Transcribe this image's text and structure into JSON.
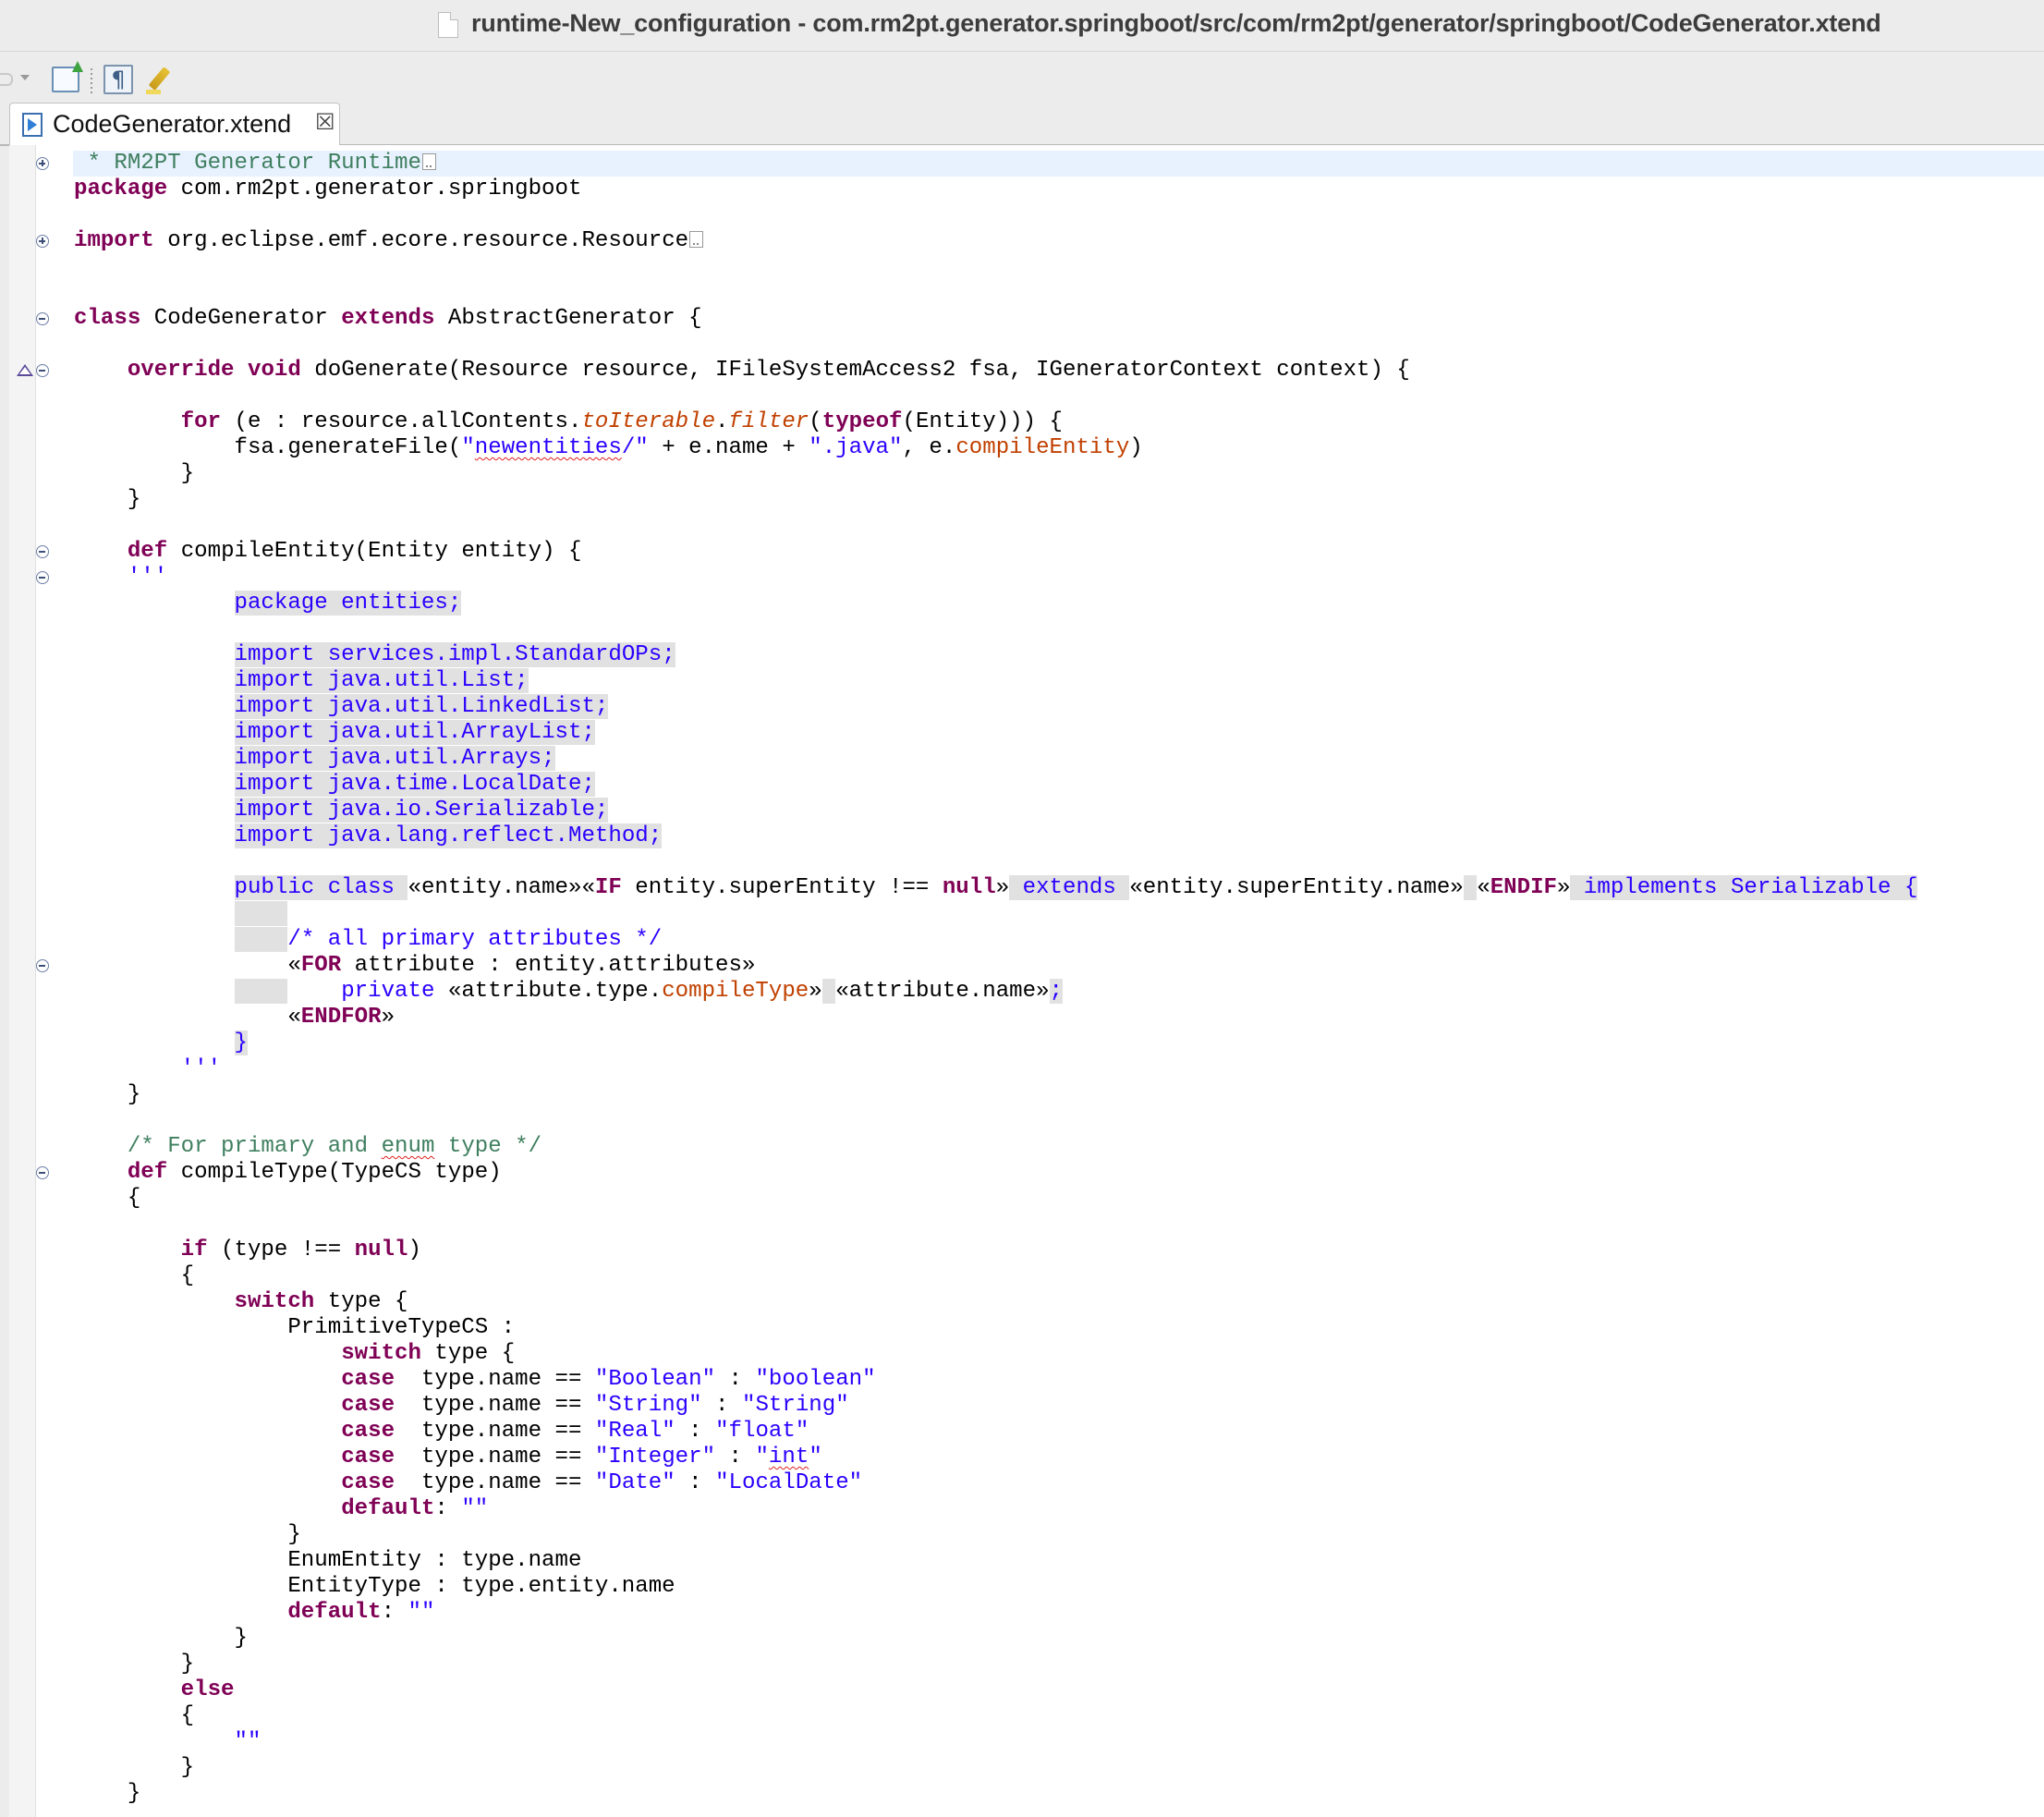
{
  "window": {
    "title": "runtime-New_configuration - com.rm2pt.generator.springboot/src/com/rm2pt/generator/springboot/CodeGenerator.xtend"
  },
  "toolbar": {
    "pilcrow_glyph": "¶",
    "icons": [
      "back-arrow-icon",
      "dropdown-icon",
      "new-wizard-icon",
      "pilcrow-icon",
      "highlight-icon"
    ]
  },
  "tab": {
    "label": "CodeGenerator.xtend",
    "close_glyph": "☒"
  },
  "colors": {
    "keyword": "#7f0055",
    "comment": "#3f7f5f",
    "string": "#2a00ff",
    "extension": "#c04000",
    "template_bg": "#e1e1e1",
    "current_line": "#e8f2fe"
  },
  "code_lines": [
    [
      {
        "t": "cm",
        "v": " * RM2PT Generator Runtime"
      },
      {
        "t": "fold"
      }
    ],
    [
      {
        "t": "kw",
        "v": "package"
      },
      {
        "t": "tk",
        "v": " com.rm2pt.generator.springboot"
      }
    ],
    [],
    [
      {
        "t": "kw",
        "v": "import"
      },
      {
        "t": "tk",
        "v": " org.eclipse.emf.ecore.resource.Resource"
      },
      {
        "t": "fold"
      }
    ],
    [],
    [],
    [
      {
        "t": "kw",
        "v": "class"
      },
      {
        "t": "tk",
        "v": " CodeGenerator "
      },
      {
        "t": "kw",
        "v": "extends"
      },
      {
        "t": "tk",
        "v": " AbstractGenerator {"
      }
    ],
    [],
    [
      {
        "t": "tk",
        "v": "    "
      },
      {
        "t": "kw",
        "v": "override"
      },
      {
        "t": "tk",
        "v": " "
      },
      {
        "t": "kw",
        "v": "void"
      },
      {
        "t": "tk",
        "v": " doGenerate(Resource resource, IFileSystemAccess2 fsa, IGeneratorContext context) {"
      }
    ],
    [],
    [
      {
        "t": "tk",
        "v": "        "
      },
      {
        "t": "kw",
        "v": "for"
      },
      {
        "t": "tk",
        "v": " (e : resource.allContents."
      },
      {
        "t": "ext",
        "v": "toIterable"
      },
      {
        "t": "tk",
        "v": "."
      },
      {
        "t": "ext",
        "v": "filter"
      },
      {
        "t": "tk",
        "v": "("
      },
      {
        "t": "kw",
        "v": "typeof"
      },
      {
        "t": "tk",
        "v": "(Entity))) {"
      }
    ],
    [
      {
        "t": "tk",
        "v": "            fsa.generateFile("
      },
      {
        "t": "st",
        "v": "\""
      },
      {
        "t": "stsq",
        "v": "newentities"
      },
      {
        "t": "st",
        "v": "/\""
      },
      {
        "t": "tk",
        "v": " + e.name + "
      },
      {
        "t": "st",
        "v": "\".java\""
      },
      {
        "t": "tk",
        "v": ", e."
      },
      {
        "t": "me",
        "v": "compileEntity"
      },
      {
        "t": "tk",
        "v": ")"
      }
    ],
    [
      {
        "t": "tk",
        "v": "        }"
      }
    ],
    [
      {
        "t": "tk",
        "v": "    }"
      }
    ],
    [],
    [
      {
        "t": "tk",
        "v": "    "
      },
      {
        "t": "kw",
        "v": "def"
      },
      {
        "t": "tk",
        "v": " compileEntity(Entity entity) {"
      }
    ],
    [
      {
        "t": "tk",
        "v": "    "
      },
      {
        "t": "st",
        "v": "'''"
      }
    ],
    [
      {
        "t": "tk",
        "v": "            "
      },
      {
        "t": "tpl",
        "v": "package entities;"
      }
    ],
    [],
    [
      {
        "t": "tk",
        "v": "            "
      },
      {
        "t": "tpl",
        "v": "import services.impl.StandardOPs;"
      }
    ],
    [
      {
        "t": "tk",
        "v": "            "
      },
      {
        "t": "tpl",
        "v": "import java.util.List;"
      }
    ],
    [
      {
        "t": "tk",
        "v": "            "
      },
      {
        "t": "tpl",
        "v": "import java.util.LinkedList;"
      }
    ],
    [
      {
        "t": "tk",
        "v": "            "
      },
      {
        "t": "tpl",
        "v": "import java.util.ArrayList;"
      }
    ],
    [
      {
        "t": "tk",
        "v": "            "
      },
      {
        "t": "tpl",
        "v": "import java.util.Arrays;"
      }
    ],
    [
      {
        "t": "tk",
        "v": "            "
      },
      {
        "t": "tpl",
        "v": "import java.time.LocalDate;"
      }
    ],
    [
      {
        "t": "tk",
        "v": "            "
      },
      {
        "t": "tpl",
        "v": "import java.io.Serializable;"
      }
    ],
    [
      {
        "t": "tk",
        "v": "            "
      },
      {
        "t": "tpl",
        "v": "import java.lang.reflect.Method;"
      }
    ],
    [],
    [
      {
        "t": "tk",
        "v": "            "
      },
      {
        "t": "tpl",
        "v": "public class "
      },
      {
        "t": "tk",
        "v": "«entity.name»«"
      },
      {
        "t": "kw",
        "v": "IF"
      },
      {
        "t": "tk",
        "v": " entity.superEntity !== "
      },
      {
        "t": "kw",
        "v": "null"
      },
      {
        "t": "tk",
        "v": "»"
      },
      {
        "t": "tpl",
        "v": " extends "
      },
      {
        "t": "tk",
        "v": "«entity.superEntity.name»"
      },
      {
        "t": "tpl",
        "v": " "
      },
      {
        "t": "tk",
        "v": "«"
      },
      {
        "t": "kw",
        "v": "ENDIF"
      },
      {
        "t": "tk",
        "v": "»"
      },
      {
        "t": "tpl",
        "v": " implements Serializable {"
      }
    ],
    [
      {
        "t": "tk",
        "v": "            "
      },
      {
        "t": "tpl",
        "v": "    "
      }
    ],
    [
      {
        "t": "tk",
        "v": "            "
      },
      {
        "t": "tpl",
        "v": "    "
      },
      {
        "t": "tb2",
        "v": "/* all primary attributes */"
      }
    ],
    [
      {
        "t": "tk",
        "v": "                «"
      },
      {
        "t": "kw",
        "v": "FOR"
      },
      {
        "t": "tk",
        "v": " attribute : entity.attributes»"
      }
    ],
    [
      {
        "t": "tk",
        "v": "            "
      },
      {
        "t": "tpl",
        "v": "    "
      },
      {
        "t": "tb2",
        "v": "    private "
      },
      {
        "t": "tk",
        "v": "«attribute.type."
      },
      {
        "t": "me",
        "v": "compileType"
      },
      {
        "t": "tk",
        "v": "»"
      },
      {
        "t": "tpl",
        "v": " "
      },
      {
        "t": "tk",
        "v": "«attribute.name»"
      },
      {
        "t": "tpl",
        "v": ";"
      }
    ],
    [
      {
        "t": "tk",
        "v": "                «"
      },
      {
        "t": "kw",
        "v": "ENDFOR"
      },
      {
        "t": "tk",
        "v": "»"
      }
    ],
    [
      {
        "t": "tk",
        "v": "            "
      },
      {
        "t": "tpl",
        "v": "}"
      }
    ],
    [
      {
        "t": "tk",
        "v": "        "
      },
      {
        "t": "st",
        "v": "'''"
      }
    ],
    [
      {
        "t": "tk",
        "v": "    }"
      }
    ],
    [],
    [
      {
        "t": "tk",
        "v": "    "
      },
      {
        "t": "cm",
        "v": "/* For primary and "
      },
      {
        "t": "cmsq",
        "v": "enum"
      },
      {
        "t": "cm",
        "v": " type */"
      }
    ],
    [
      {
        "t": "tk",
        "v": "    "
      },
      {
        "t": "kw",
        "v": "def"
      },
      {
        "t": "tk",
        "v": " compileType(TypeCS type)"
      }
    ],
    [
      {
        "t": "tk",
        "v": "    {"
      }
    ],
    [],
    [
      {
        "t": "tk",
        "v": "        "
      },
      {
        "t": "kw",
        "v": "if"
      },
      {
        "t": "tk",
        "v": " (type !== "
      },
      {
        "t": "kw",
        "v": "null"
      },
      {
        "t": "tk",
        "v": ")"
      }
    ],
    [
      {
        "t": "tk",
        "v": "        {"
      }
    ],
    [
      {
        "t": "tk",
        "v": "            "
      },
      {
        "t": "kw",
        "v": "switch"
      },
      {
        "t": "tk",
        "v": " type {"
      }
    ],
    [
      {
        "t": "tk",
        "v": "                PrimitiveTypeCS :"
      }
    ],
    [
      {
        "t": "tk",
        "v": "                    "
      },
      {
        "t": "kw",
        "v": "switch"
      },
      {
        "t": "tk",
        "v": " type {"
      }
    ],
    [
      {
        "t": "tk",
        "v": "                    "
      },
      {
        "t": "kw",
        "v": "case"
      },
      {
        "t": "tk",
        "v": "  type.name == "
      },
      {
        "t": "st",
        "v": "\"Boolean\""
      },
      {
        "t": "tk",
        "v": " : "
      },
      {
        "t": "st",
        "v": "\"boolean\""
      }
    ],
    [
      {
        "t": "tk",
        "v": "                    "
      },
      {
        "t": "kw",
        "v": "case"
      },
      {
        "t": "tk",
        "v": "  type.name == "
      },
      {
        "t": "st",
        "v": "\"String\""
      },
      {
        "t": "tk",
        "v": " : "
      },
      {
        "t": "st",
        "v": "\"String\""
      }
    ],
    [
      {
        "t": "tk",
        "v": "                    "
      },
      {
        "t": "kw",
        "v": "case"
      },
      {
        "t": "tk",
        "v": "  type.name == "
      },
      {
        "t": "st",
        "v": "\"Real\""
      },
      {
        "t": "tk",
        "v": " : "
      },
      {
        "t": "st",
        "v": "\"float\""
      }
    ],
    [
      {
        "t": "tk",
        "v": "                    "
      },
      {
        "t": "kw",
        "v": "case"
      },
      {
        "t": "tk",
        "v": "  type.name == "
      },
      {
        "t": "st",
        "v": "\"Integer\""
      },
      {
        "t": "tk",
        "v": " : "
      },
      {
        "t": "st",
        "v": "\""
      },
      {
        "t": "stsq",
        "v": "int"
      },
      {
        "t": "st",
        "v": "\""
      }
    ],
    [
      {
        "t": "tk",
        "v": "                    "
      },
      {
        "t": "kw",
        "v": "case"
      },
      {
        "t": "tk",
        "v": "  type.name == "
      },
      {
        "t": "st",
        "v": "\"Date\""
      },
      {
        "t": "tk",
        "v": " : "
      },
      {
        "t": "st",
        "v": "\"LocalDate\""
      }
    ],
    [
      {
        "t": "tk",
        "v": "                    "
      },
      {
        "t": "kw",
        "v": "default"
      },
      {
        "t": "tk",
        "v": ": "
      },
      {
        "t": "st",
        "v": "\"\""
      }
    ],
    [
      {
        "t": "tk",
        "v": "                }"
      }
    ],
    [
      {
        "t": "tk",
        "v": "                EnumEntity : type.name"
      }
    ],
    [
      {
        "t": "tk",
        "v": "                EntityType : type.entity.name"
      }
    ],
    [
      {
        "t": "tk",
        "v": "                "
      },
      {
        "t": "kw",
        "v": "default"
      },
      {
        "t": "tk",
        "v": ": "
      },
      {
        "t": "st",
        "v": "\"\""
      }
    ],
    [
      {
        "t": "tk",
        "v": "            }"
      }
    ],
    [
      {
        "t": "tk",
        "v": "        }"
      }
    ],
    [
      {
        "t": "tk",
        "v": "        "
      },
      {
        "t": "kw",
        "v": "else"
      }
    ],
    [
      {
        "t": "tk",
        "v": "        {"
      }
    ],
    [
      {
        "t": "tk",
        "v": "            "
      },
      {
        "t": "st",
        "v": "\"\""
      }
    ],
    [
      {
        "t": "tk",
        "v": "        }"
      }
    ],
    [
      {
        "t": "tk",
        "v": "    }"
      }
    ]
  ],
  "fold_markers": [
    {
      "line": 0,
      "type": "expand"
    },
    {
      "line": 3,
      "type": "expand"
    },
    {
      "line": 6,
      "type": "collapse"
    },
    {
      "line": 8,
      "type": "collapse"
    },
    {
      "line": 15,
      "type": "collapse"
    },
    {
      "line": 16,
      "type": "collapse"
    },
    {
      "line": 31,
      "type": "collapse"
    },
    {
      "line": 39,
      "type": "collapse"
    }
  ],
  "override_marker_line": 8
}
